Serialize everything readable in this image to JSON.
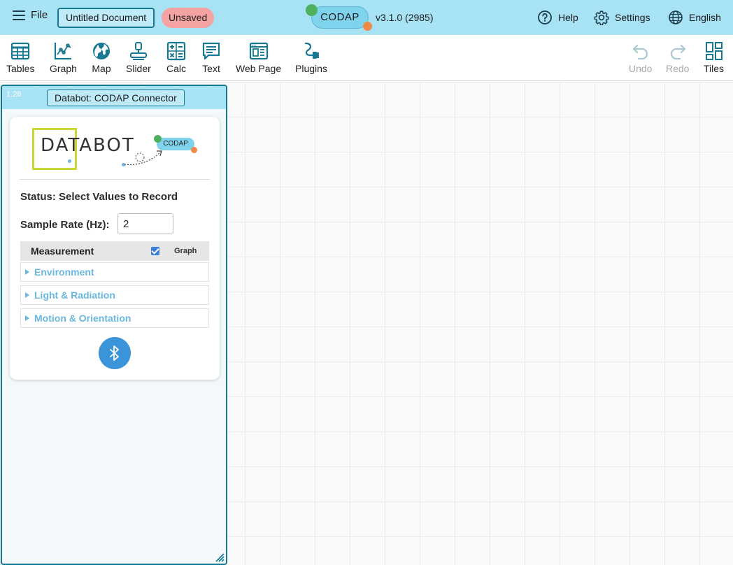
{
  "topbar": {
    "menu_label": "File",
    "document_title": "Untitled Document",
    "unsaved_badge": "Unsaved",
    "app_name": "CODAP",
    "version": "v3.1.0 (2985)",
    "help_label": "Help",
    "settings_label": "Settings",
    "language_label": "English"
  },
  "toolshelf": {
    "tools": [
      {
        "label": "Tables",
        "icon": "table-icon"
      },
      {
        "label": "Graph",
        "icon": "graph-icon"
      },
      {
        "label": "Map",
        "icon": "globe-icon"
      },
      {
        "label": "Slider",
        "icon": "slider-icon"
      },
      {
        "label": "Calc",
        "icon": "calculator-icon"
      },
      {
        "label": "Text",
        "icon": "text-icon"
      },
      {
        "label": "Web Page",
        "icon": "web-page-icon"
      },
      {
        "label": "Plugins",
        "icon": "plugin-icon"
      }
    ],
    "undo_label": "Undo",
    "redo_label": "Redo",
    "tiles_label": "Tiles"
  },
  "tile": {
    "version": "1.28",
    "title": "Databot: CODAP Connector"
  },
  "plugin": {
    "logo_text": "DATABOT",
    "logo_codap": "CODAP",
    "status": "Status: Select Values to Record",
    "sample_rate_label": "Sample Rate (Hz):",
    "sample_rate_value": "2",
    "measurement_header": "Measurement",
    "graph_header": "Graph",
    "graph_checked": true,
    "sections": [
      "Environment",
      "Light & Radiation",
      "Motion & Orientation"
    ],
    "connect_icon": "bluetooth-icon"
  },
  "colors": {
    "topbar_bg": "#a8e2f5",
    "accent": "#177991",
    "unsaved_bg": "#f4a2a2",
    "section_text": "#6ab8e0",
    "bluetooth_bg": "#3a94d9"
  }
}
